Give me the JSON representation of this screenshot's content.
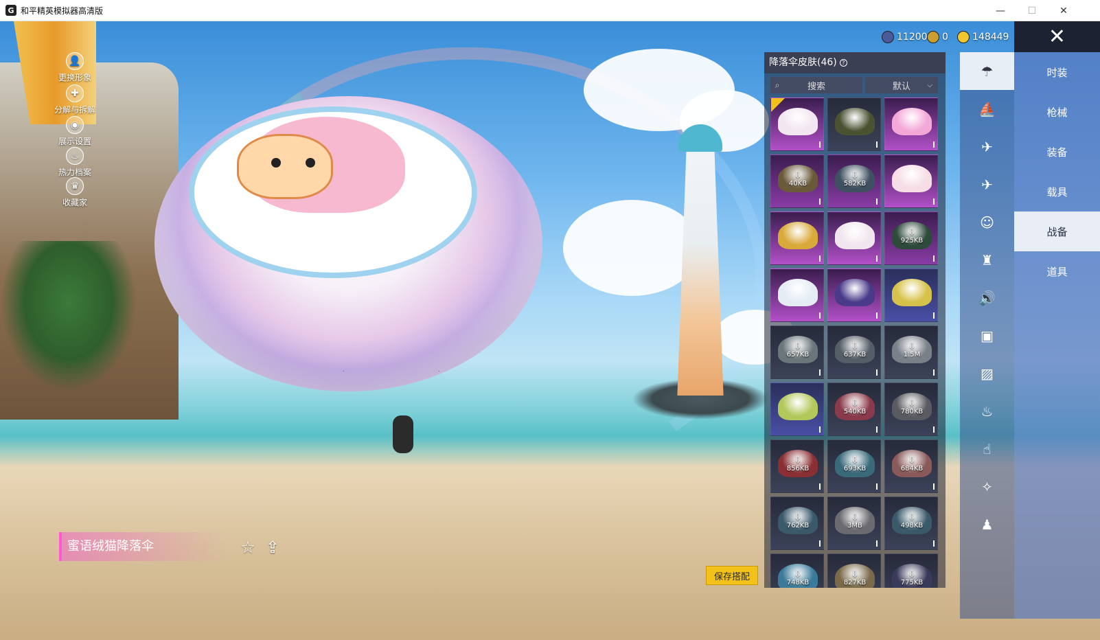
{
  "window": {
    "title": "和平精英模拟器高清版",
    "icon_letter": "G",
    "minimize": "—",
    "maximize": "☐",
    "close": "✕"
  },
  "left_menu": [
    {
      "label": "更换形象",
      "icon": "person-icon"
    },
    {
      "label": "分解与拆解",
      "icon": "puzzle-icon"
    },
    {
      "label": "展示设置",
      "icon": "eye-icon"
    },
    {
      "label": "热力档案",
      "icon": "flame-icon"
    },
    {
      "label": "收藏家",
      "icon": "crown-icon"
    }
  ],
  "item_name": "蜜语绒猫降落伞",
  "save_button": "保存搭配",
  "currencies": [
    {
      "value": "11200",
      "icon": "globe-coin-icon",
      "color": "#4a5a9a"
    },
    {
      "value": "0",
      "icon": "gold-coin-icon",
      "color": "#c9a030"
    },
    {
      "value": "148449",
      "icon": "yellow-coin-icon",
      "color": "#f2c630"
    }
  ],
  "panel": {
    "title": "降落伞皮肤(46)",
    "help": "?",
    "search_placeholder": "搜索",
    "sort_value": "默认"
  },
  "grid": [
    {
      "style": "bright",
      "color": "#f2e6f0",
      "dl": "",
      "equipped": true
    },
    {
      "style": "dark",
      "color": "#4a5232",
      "dl": ""
    },
    {
      "style": "bright",
      "color": "#f3a8d8",
      "dl": ""
    },
    {
      "style": "purple",
      "color": "#6b5a3a",
      "dl": "40KB"
    },
    {
      "style": "purple",
      "color": "#3f5060",
      "dl": "582KB"
    },
    {
      "style": "bright",
      "color": "#f6dde6",
      "dl": ""
    },
    {
      "style": "bright",
      "color": "#d9a93a",
      "dl": ""
    },
    {
      "style": "bright",
      "color": "#f1e6ee",
      "dl": ""
    },
    {
      "style": "purple",
      "color": "#2e4a3a",
      "dl": "925KB"
    },
    {
      "style": "bright",
      "color": "#e4ecf4",
      "dl": ""
    },
    {
      "style": "bright",
      "color": "#4a3a8a",
      "dl": ""
    },
    {
      "style": "blue",
      "color": "#d6c24a",
      "dl": ""
    },
    {
      "style": "dark",
      "color": "#6a767a",
      "dl": "657KB"
    },
    {
      "style": "dark",
      "color": "#555d66",
      "dl": "637KB"
    },
    {
      "style": "dark",
      "color": "#7a8088",
      "dl": "1.5M"
    },
    {
      "style": "blue",
      "color": "#b2c85a",
      "dl": ""
    },
    {
      "style": "dark",
      "color": "#8a3a4a",
      "dl": "540KB"
    },
    {
      "style": "dark",
      "color": "#5a5a62",
      "dl": "780KB"
    },
    {
      "style": "dark",
      "color": "#8a3034",
      "dl": "856KB"
    },
    {
      "style": "dark",
      "color": "#3a6a7a",
      "dl": "693KB"
    },
    {
      "style": "dark",
      "color": "#8a5a5a",
      "dl": "684KB"
    },
    {
      "style": "dark",
      "color": "#3a5a6a",
      "dl": "762KB"
    },
    {
      "style": "dark",
      "color": "#6a6a70",
      "dl": "3MB"
    },
    {
      "style": "dark",
      "color": "#3a5a6a",
      "dl": "498KB"
    },
    {
      "style": "dark",
      "color": "#3a7a9a",
      "dl": "748KB"
    },
    {
      "style": "dark",
      "color": "#7a6a4a",
      "dl": "827KB"
    },
    {
      "style": "dark",
      "color": "#3a3a5a",
      "dl": "775KB"
    }
  ],
  "download_arrow": "⇩",
  "icon_column": [
    {
      "glyph": "☂",
      "name": "parachute-category-icon",
      "active": true
    },
    {
      "glyph": "⛵",
      "name": "boat-icon"
    },
    {
      "glyph": "✈",
      "name": "drone-icon"
    },
    {
      "glyph": "✈",
      "name": "plane-icon"
    },
    {
      "glyph": "☺",
      "name": "emote-icon"
    },
    {
      "glyph": "♜",
      "name": "backpack-icon"
    },
    {
      "glyph": "🔊",
      "name": "voice-icon"
    },
    {
      "glyph": "▣",
      "name": "card-icon"
    },
    {
      "glyph": "▨",
      "name": "picture-icon"
    },
    {
      "glyph": "♨",
      "name": "spray-icon"
    },
    {
      "glyph": "☝",
      "name": "tap-icon"
    },
    {
      "glyph": "✧",
      "name": "magic-wand-icon"
    },
    {
      "glyph": "♟",
      "name": "pet-icon"
    }
  ],
  "categories": [
    {
      "label": "时装"
    },
    {
      "label": "枪械"
    },
    {
      "label": "装备"
    },
    {
      "label": "载具"
    },
    {
      "label": "战备",
      "active": true
    },
    {
      "label": "道具"
    }
  ],
  "close_panel": "✕",
  "favorite_icon": "☆",
  "share_icon": "⇪"
}
